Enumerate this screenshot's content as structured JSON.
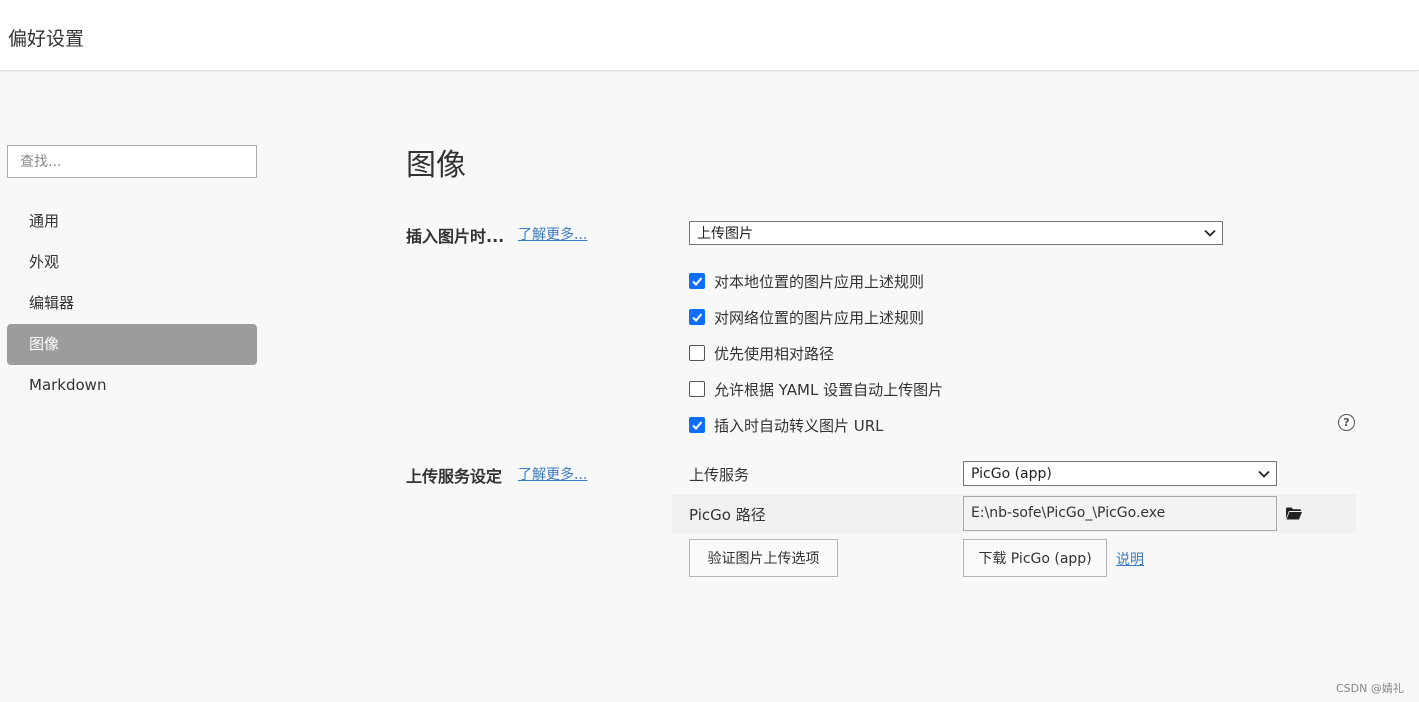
{
  "window": {
    "title": "偏好设置"
  },
  "sidebar": {
    "search_placeholder": "查找...",
    "items": [
      {
        "label": "通用",
        "active": false
      },
      {
        "label": "外观",
        "active": false
      },
      {
        "label": "编辑器",
        "active": false
      },
      {
        "label": "图像",
        "active": true
      },
      {
        "label": "Markdown",
        "active": false
      }
    ]
  },
  "main": {
    "title": "图像",
    "insert_section": {
      "label": "插入图片时...",
      "learn_more": "了解更多...",
      "action_select": "上传图片",
      "options": [
        {
          "label": "对本地位置的图片应用上述规则",
          "checked": true
        },
        {
          "label": "对网络位置的图片应用上述规则",
          "checked": true
        },
        {
          "label": "优先使用相对路径",
          "checked": false
        },
        {
          "label": "允许根据 YAML 设置自动上传图片",
          "checked": false
        },
        {
          "label": "插入时自动转义图片 URL",
          "checked": true
        }
      ],
      "help_icon": "question-circle-icon"
    },
    "upload_section": {
      "label": "上传服务设定",
      "learn_more": "了解更多...",
      "service_label": "上传服务",
      "service_select": "PicGo (app)",
      "path_label": "PicGo 路径",
      "path_value": "E:\\nb-sofe\\PicGo_\\PicGo.exe",
      "folder_icon": "folder-icon",
      "verify_button": "验证图片上传选项",
      "download_button": "下载 PicGo (app)",
      "explain_link": "说明"
    }
  },
  "watermark": "CSDN @婧礼",
  "colors": {
    "accent": "#0d6efd",
    "link": "#3a7cc3",
    "active_nav": "#9c9c9c"
  }
}
